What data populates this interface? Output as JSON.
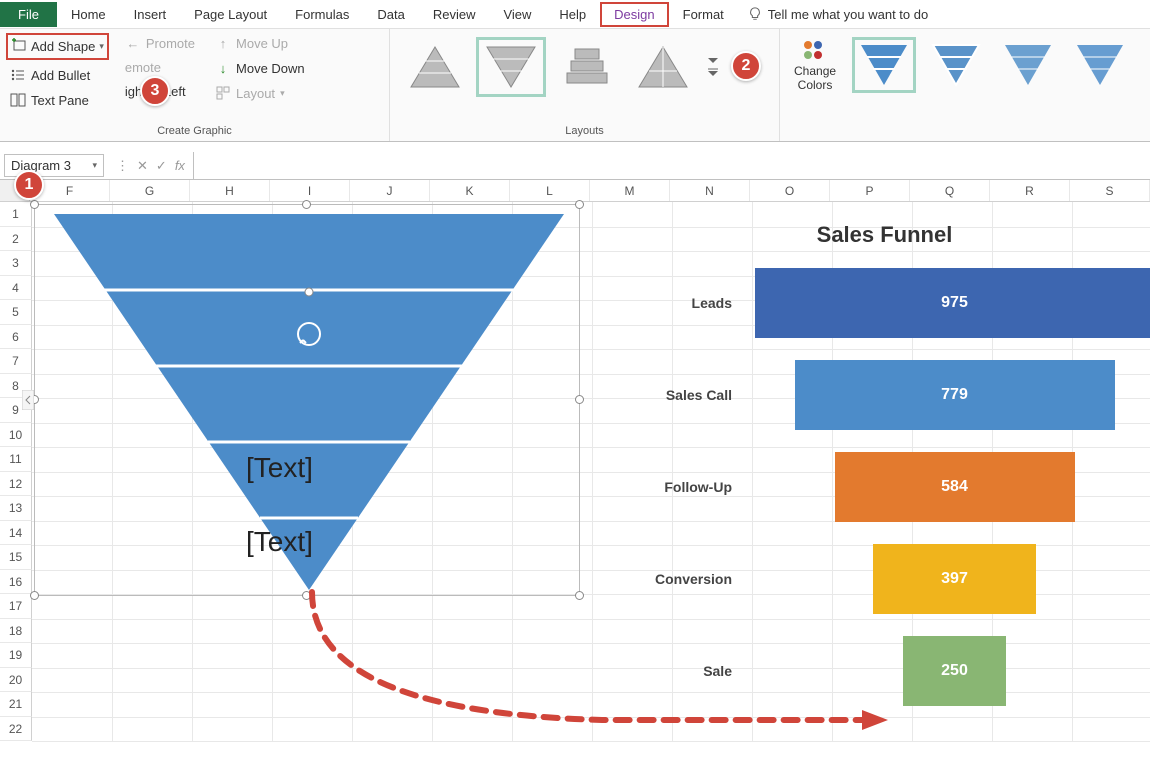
{
  "tabs": {
    "file": "File",
    "home": "Home",
    "insert": "Insert",
    "page_layout": "Page Layout",
    "formulas": "Formulas",
    "data": "Data",
    "review": "Review",
    "view": "View",
    "help": "Help",
    "design": "Design",
    "format": "Format",
    "tell_me": "Tell me what you want to do"
  },
  "ribbon": {
    "create_graphic": {
      "label": "Create Graphic",
      "add_shape": "Add Shape",
      "add_bullet": "Add Bullet",
      "text_pane": "Text Pane",
      "promote": "Promote",
      "demote": "emote",
      "right_to_left": "ight to Left",
      "move_up": "Move Up",
      "move_down": "Move Down",
      "layout": "Layout"
    },
    "layouts": {
      "label": "Layouts"
    },
    "change_colors": "Change\nColors"
  },
  "callouts": {
    "c1": "1",
    "c2": "2",
    "c3": "3"
  },
  "formula_bar": {
    "name_box": "Diagram 3",
    "fx": "fx"
  },
  "columns": [
    "F",
    "G",
    "H",
    "I",
    "J",
    "K",
    "L",
    "M",
    "N",
    "O",
    "P",
    "Q",
    "R",
    "S"
  ],
  "rows": [
    "1",
    "2",
    "3",
    "4",
    "5",
    "6",
    "7",
    "8",
    "9",
    "10",
    "11",
    "12",
    "13",
    "14",
    "15",
    "16",
    "17",
    "18",
    "19",
    "20",
    "21",
    "22"
  ],
  "smartart": {
    "text1": "[Text]",
    "text2": "[Text]"
  },
  "chart_data": {
    "type": "bar",
    "title": "Sales Funnel",
    "categories": [
      "Leads",
      "Sales Call",
      "Follow-Up",
      "Conversion",
      "Sale"
    ],
    "values": [
      975,
      779,
      584,
      397,
      250
    ],
    "colors": [
      "#3d66b0",
      "#4c8cc9",
      "#e37a2e",
      "#f0b41c",
      "#89b673"
    ],
    "xlabel": "",
    "ylabel": "",
    "ylim": [
      0,
      1000
    ]
  }
}
